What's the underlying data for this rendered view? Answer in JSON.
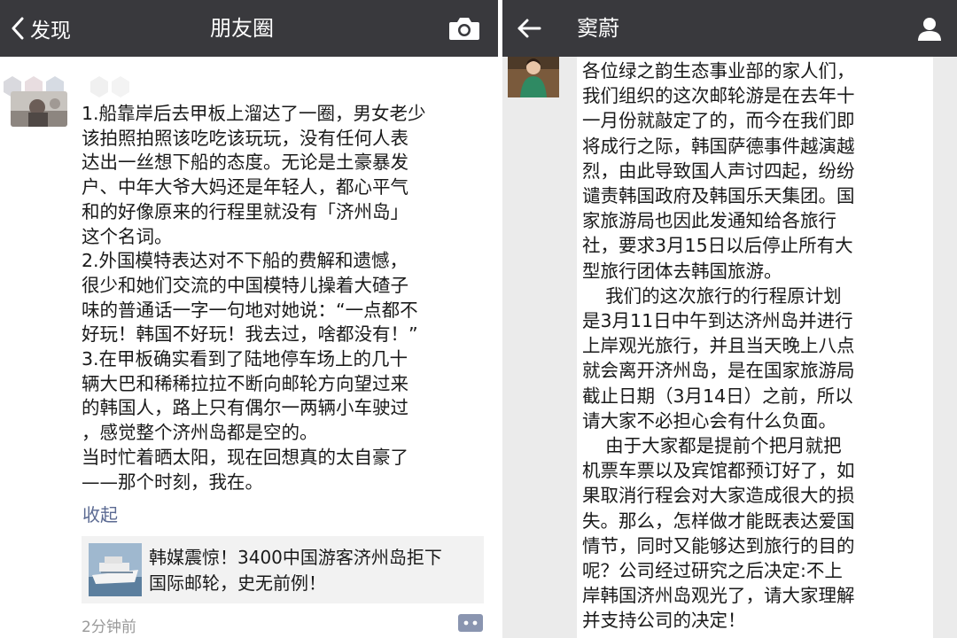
{
  "left": {
    "nav": {
      "back_label": "发现",
      "title": "朋友圈"
    },
    "post_lines": [
      "1.船靠岸后去甲板上溜达了一圈，男女老少",
      "该拍照拍照该吃吃该玩玩，没有任何人表",
      "达出一丝想下船的态度。无论是土豪暴发",
      "户、中年大爷大妈还是年轻人，都心平气",
      "和的好像原来的行程里就没有「济州岛」",
      "这个名词。",
      "2.外国模特表达对不下船的费解和遗憾，",
      "很少和她们交流的中国模特儿操着大碴子",
      "味的普通话一字一句地对她说：“一点都不",
      "好玩！韩国不好玩！我去过，啥都没有！”",
      "3.在甲板确实看到了陆地停车场上的几十",
      "辆大巴和稀稀拉拉不断向邮轮方向望过来",
      "的韩国人，路上只有偶尔一两辆小车驶过",
      "，感觉整个济州岛都是空的。",
      "当时忙着晒太阳，现在回想真的太自豪了",
      "——那个时刻，我在。"
    ],
    "collapse_label": "收起",
    "share_title_lines": [
      "韩媒震惊！3400中国游客济州岛拒下",
      "国际邮轮，史无前例！"
    ],
    "time": "2分钟前"
  },
  "right": {
    "nav": {
      "title": "窦蔚"
    },
    "message_lines": [
      "各位绿之韵生态事业部的家人们，",
      "我们组织的这次邮轮游是在去年十",
      "一月份就敲定了的，而今在我们即",
      "将成行之际，韩国萨德事件越演越",
      "烈，由此导致国人声讨四起，纷纷",
      "谴责韩国政府及韩国乐天集团。国",
      "家旅游局也因此发通知给各旅行",
      "社，要求3月15日以后停止所有大",
      "型旅行团体去韩国旅游。",
      "    我们的这次旅行的行程原计划",
      "是3月11日中午到达济州岛并进行",
      "上岸观光旅行，并且当天晚上八点",
      "就会离开济州岛，是在国家旅游局",
      "截止日期（3月14日）之前，所以",
      "请大家不必担心会有什么负面。",
      "    由于大家都是提前个把月就把",
      "机票车票以及宾馆都预订好了，如",
      "果取消行程会对大家造成很大的损",
      "失。那么，怎样做才能既表达爱国",
      "情节，同时又能够达到旅行的目的",
      "呢？公司经过研究之后决定:不上",
      "岸韩国济州岛观光了，请大家理解",
      "并支持公司的决定！"
    ]
  },
  "icons": {
    "back": "chevron-left-icon",
    "camera": "camera-icon",
    "arrow": "arrow-left-icon",
    "profile": "person-icon",
    "comment": "comment-more-icon"
  },
  "colors": {
    "navbar": "#39393d",
    "link": "#5b6a92",
    "chat_bg": "#ebebeb",
    "share_bg": "#f2f2f2"
  }
}
